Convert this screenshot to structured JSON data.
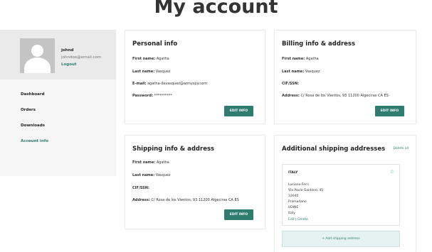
{
  "page": {
    "title": "My account"
  },
  "profile": {
    "username": "johnd",
    "email": "johndoe@email.com",
    "logout_label": "Logout"
  },
  "nav": {
    "items": [
      {
        "label": "Dashboard"
      },
      {
        "label": "Orders"
      },
      {
        "label": "Downloads"
      },
      {
        "label": "Account info"
      }
    ]
  },
  "personal": {
    "title": "Personal info",
    "first_name_label": "First name:",
    "first_name": "Agatha",
    "last_name_label": "Last name:",
    "last_name": "Vasquez",
    "email_label": "E-mail:",
    "email": "agatha-llavasquez@armyspy.com",
    "password_label": "Password:",
    "password": "**********",
    "edit_label": "EDIT INFO"
  },
  "billing": {
    "title": "Billing info & address",
    "first_name_label": "First name:",
    "first_name": "Agatha",
    "last_name_label": "Last name:",
    "last_name": "Vasquez",
    "cif_label": "CIF/SSN:",
    "address_label": "Address:",
    "address": "C/ Rosa de los Vientos, 93 11200 Algeciras CA ES",
    "edit_label": "EDIT INFO"
  },
  "shipping": {
    "title": "Shipping info & address",
    "first_name_label": "First name:",
    "first_name": "Agatha",
    "last_name_label": "Last name:",
    "last_name": "Vasquez",
    "cif_label": "CIF/SSN:",
    "address_label": "Address:",
    "address": "C/ Rosa de los Vientos, 93 11200 Algeciras CA ES",
    "edit_label": "EDIT INFO"
  },
  "additional": {
    "title": "Additional shipping addresses",
    "delete_all_label": "Delete all",
    "address": {
      "country": "ITALY",
      "name": "Luciano Ferri",
      "street": "Via Paolo Gaidano, 45",
      "zip": "33040",
      "town": "Pramadano",
      "province": "UDINE",
      "country_line": "Italy",
      "edit_label": "Edit",
      "separator": "|",
      "delete_label": "Delete"
    },
    "add_label": "+ Add shipping address"
  },
  "icons": {
    "favorite": "star-icon",
    "avatar": "avatar-placeholder"
  },
  "colors": {
    "accent": "#2e7d6e",
    "sidebar_bg": "#f6f6f6",
    "add_bg": "#e6f2f1"
  }
}
